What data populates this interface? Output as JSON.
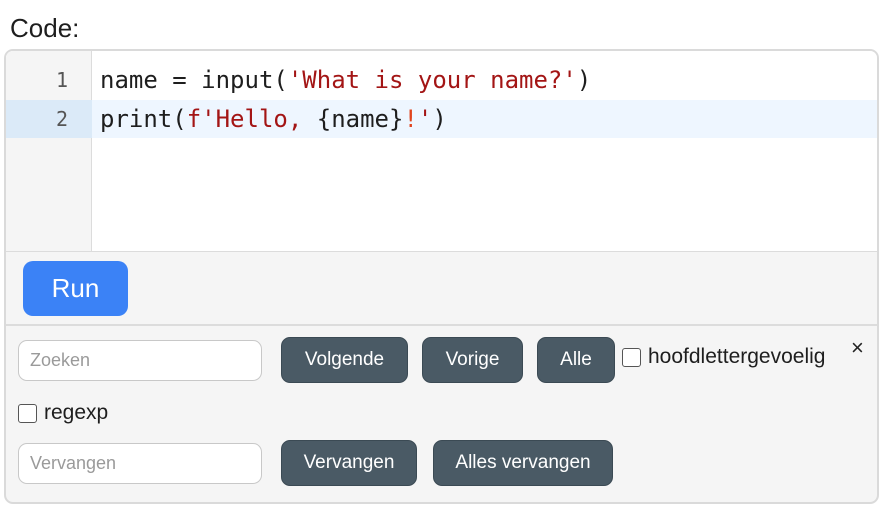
{
  "title": "Code:",
  "editor": {
    "lines": [
      {
        "number": "1",
        "parts": {
          "a": "name = input(",
          "b": "'What is your name?'",
          "c": ")"
        }
      },
      {
        "number": "2",
        "parts": {
          "a": "print(",
          "b": "f'Hello, ",
          "c": "{name}",
          "d": "!",
          "e": "'",
          "f": ")"
        }
      }
    ]
  },
  "run": {
    "label": "Run"
  },
  "search": {
    "placeholder": "Zoeken",
    "next_label": "Volgende",
    "prev_label": "Vorige",
    "all_label": "Alle",
    "case_label": "hoofdlettergevoelig",
    "regexp_label": "regexp",
    "close_label": "×"
  },
  "replace": {
    "placeholder": "Vervangen",
    "replace_label": "Vervangen",
    "replace_all_label": "Alles vervangen"
  },
  "colors": {
    "accent": "#3b82f6",
    "button": "#4a5a65",
    "string": "#a31515",
    "active_line": "#eef6ff"
  }
}
